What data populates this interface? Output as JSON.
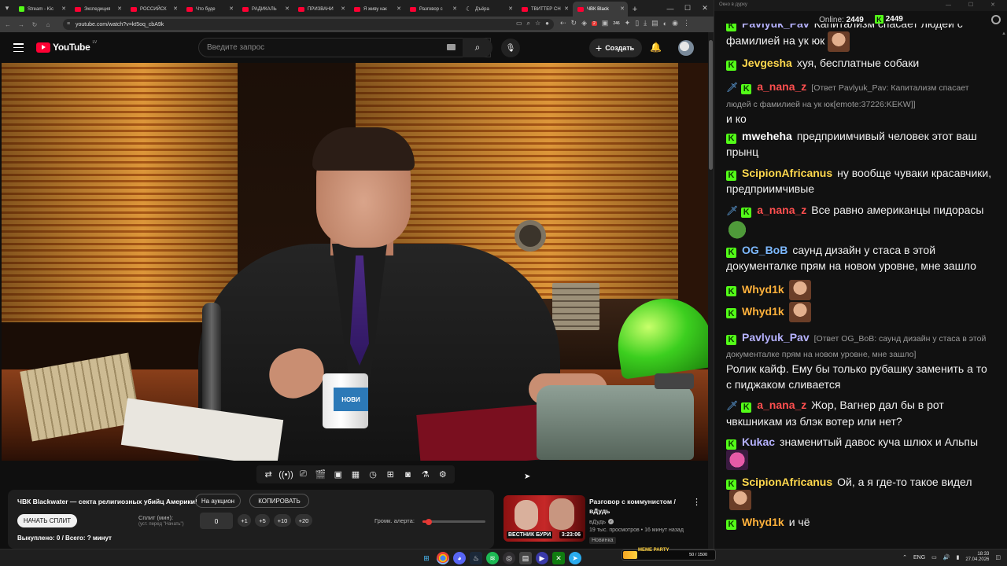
{
  "browser": {
    "tabs": [
      {
        "label": "Stream - Kic",
        "icon": "kick",
        "active": false
      },
      {
        "label": "Экспедиция",
        "icon": "youtube",
        "active": false
      },
      {
        "label": "РОССИЙСК",
        "icon": "youtube",
        "active": false
      },
      {
        "label": "Что буде",
        "icon": "youtube",
        "active": false
      },
      {
        "label": "РАДИКАЛЬ",
        "icon": "youtube",
        "active": false
      },
      {
        "label": "ПРИЗВАНИ",
        "icon": "youtube",
        "active": false
      },
      {
        "label": "Я живу как",
        "icon": "youtube",
        "active": false
      },
      {
        "label": "Разговор с",
        "icon": "youtube",
        "active": false
      },
      {
        "label": "Дъёра",
        "icon": "moon",
        "active": false
      },
      {
        "label": "ТВИТТЕР СН",
        "icon": "youtube",
        "active": false
      },
      {
        "label": "ЧВК Black",
        "icon": "youtube",
        "active": true
      }
    ],
    "url": "youtube.com/watch?v=kt5oq_cbA9k",
    "ext_badge_1": "2",
    "ext_badge_2": "246"
  },
  "youtube": {
    "logo_text": "YouTube",
    "region": "LV",
    "search_placeholder": "Введите запрос",
    "create_label": "Создать",
    "mug_text": "НОВИ"
  },
  "player_tools": [
    "repeat-icon",
    "broadcast-icon",
    "cast-icon",
    "clapper-icon",
    "screenshot-icon",
    "film-strip-icon",
    "speed-icon",
    "add-image-icon",
    "camera-icon",
    "flask-icon",
    "gear-icon"
  ],
  "split_panel": {
    "title": "ЧВК Blackwater — секта религиозных убийц Америки!",
    "auction_label": "На аукцион",
    "copy_label": "КОПИРОВАТЬ",
    "start_label": "НАЧАТЬ СПЛИТ",
    "split_label": "Сплит (мин):",
    "split_hint": "(уст. перед \"Начать\")",
    "split_value": "0",
    "steps": [
      "+1",
      "+5",
      "+10",
      "+20"
    ],
    "alert_label": "Громк. алерта:",
    "alert_volume": 0.1,
    "bought": "Выкуплено: 0 / Всего: ? минут"
  },
  "recommended": {
    "title": "Разговор с коммунистом / вДудь",
    "channel": "вДудь",
    "views": "19 тыс. просмотров",
    "age": "16 минут назад",
    "badge": "Новинка",
    "duration": "3:23:06",
    "thumb_label": "ВЕСТНИК БУРИ"
  },
  "chat": {
    "window_title": "Окно в дурку",
    "online_label": "Online:",
    "online_count": "2449",
    "kick_count": "2449",
    "messages": [
      {
        "user": "Pavlyuk_Pav",
        "color": "#b6b2ff",
        "sword": false,
        "reply": "",
        "text": "Капитализм спасает людей с фамилией на ук юк",
        "emote": "face"
      },
      {
        "user": "Jevgesha",
        "color": "#ffd84d",
        "sword": false,
        "reply": "",
        "text": "хуя, бесплатные собаки",
        "emote": ""
      },
      {
        "user": "a_nana_z",
        "color": "#ff4f4f",
        "sword": true,
        "reply": "[Ответ Pavlyuk_Pav: Капитализм спасает людей с фамилией на ук юк[emote:37226:KEKW]]",
        "text": "и ко",
        "emote": ""
      },
      {
        "user": "mweheha",
        "color": "#ffffff",
        "sword": false,
        "reply": "",
        "text": "предприимчивый человек этот ваш прынц",
        "emote": ""
      },
      {
        "user": "ScipionAfricanus",
        "color": "#ffd84d",
        "sword": false,
        "reply": "",
        "text": "ну вообще чуваки красавчики, предприимчивые",
        "emote": ""
      },
      {
        "user": "a_nana_z",
        "color": "#ff4f4f",
        "sword": true,
        "reply": "",
        "text": "Все равно американцы пидорасы",
        "emote": "pepe"
      },
      {
        "user": "OG_BoB",
        "color": "#7db9ff",
        "sword": false,
        "reply": "",
        "text": "саунд дизайн у стаса в этой документалке прям на новом уровне, мне зашло",
        "emote": ""
      },
      {
        "user": "Whyd1k",
        "color": "#ffb13b",
        "sword": false,
        "reply": "",
        "text": "",
        "emote": "face"
      },
      {
        "user": "Whyd1k",
        "color": "#ffb13b",
        "sword": false,
        "reply": "",
        "text": "",
        "emote": "face"
      },
      {
        "user": "Pavlyuk_Pav",
        "color": "#b6b2ff",
        "sword": false,
        "reply": "[Ответ OG_BoB: саунд дизайн у стаса в этой документалке прям на новом уровне, мне зашло]",
        "text": "Ролик кайф. Ему бы только рубашку заменить а то с пиджаком сливается",
        "emote": ""
      },
      {
        "user": "a_nana_z",
        "color": "#ff4f4f",
        "sword": true,
        "reply": "",
        "text": "Жор, Вагнер дал бы в рот чвкшникам из блэк вотер или нет?",
        "emote": ""
      },
      {
        "user": "Kukac",
        "color": "#b6b2ff",
        "sword": false,
        "reply": "",
        "text": "знаменитый давос куча шлюх и Альпы",
        "emote": "pink"
      },
      {
        "user": "ScipionAfricanus",
        "color": "#ffd84d",
        "sword": false,
        "reply": "",
        "text": "Ой, а я где-то такое видел",
        "emote": "face"
      },
      {
        "user": "Whyd1k",
        "color": "#ffb13b",
        "sword": false,
        "reply": "",
        "text": "и чё",
        "emote": ""
      }
    ]
  },
  "taskbar": {
    "apps": [
      "windows",
      "chrome",
      "discord",
      "steam",
      "spotify",
      "obs",
      "notes",
      "media",
      "xbox",
      "telegram"
    ],
    "meme_label": "MEME PARTY",
    "meme_count": "50 / 1500",
    "meme_progress": 0.033,
    "lang": "ENG",
    "time": "18:33",
    "date": "27.04.2026"
  },
  "colors": {
    "kick_green": "#53fc18",
    "yt_red": "#ff0033",
    "bg": "#0f0f0f"
  }
}
